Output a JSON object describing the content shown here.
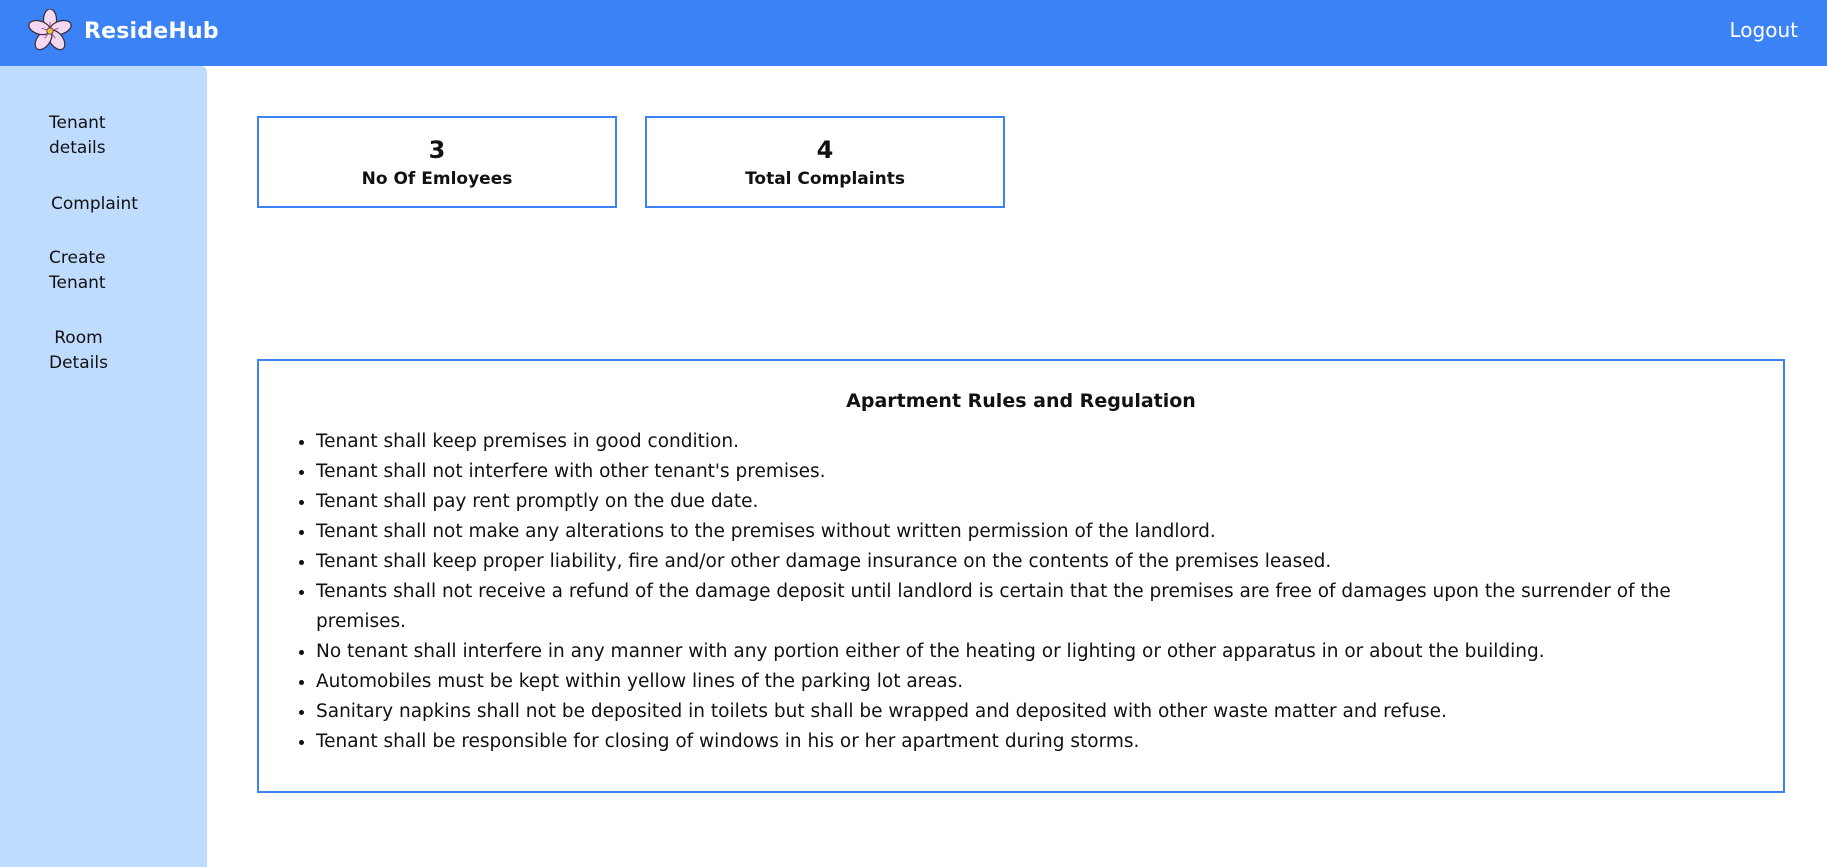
{
  "header": {
    "brand_name": "ResideHub",
    "logo_icon": "flower-logo-icon",
    "logout_label": "Logout",
    "background_color": "#3b82f6"
  },
  "sidebar": {
    "background_color": "#bfdbfe",
    "items": [
      {
        "line1": "Tenant",
        "line2": "details"
      },
      {
        "line1": "Complaint",
        "line2": ""
      },
      {
        "line1": "Create",
        "line2": "Tenant"
      },
      {
        "line1": "Room",
        "line2": "Details"
      }
    ]
  },
  "stats": [
    {
      "value": "3",
      "label": "No Of Emloyees"
    },
    {
      "value": "4",
      "label": "Total Complaints"
    }
  ],
  "rules": {
    "title": "Apartment Rules and Regulation",
    "items": [
      "Tenant shall keep premises in good condition.",
      "Tenant shall not interfere with other tenant's premises.",
      "Tenant shall pay rent promptly on the due date.",
      "Tenant shall not make any alterations to the premises without written permission of the landlord.",
      "Tenant shall keep proper liability, fire and/or other damage insurance on the contents of the premises leased.",
      "Tenants shall not receive a refund of the damage deposit until landlord is certain that the premises are free of damages upon the surrender of the premises.",
      "No tenant shall interfere in any manner with any portion either of the heating or lighting or other apparatus in or about the building.",
      "Automobiles must be kept within yellow lines of the parking lot areas.",
      "Sanitary napkins shall not be deposited in toilets but shall be wrapped and deposited with other waste matter and refuse.",
      "Tenant shall be responsible for closing of windows in his or her apartment during storms."
    ]
  },
  "accent_color": "#3b82f6"
}
